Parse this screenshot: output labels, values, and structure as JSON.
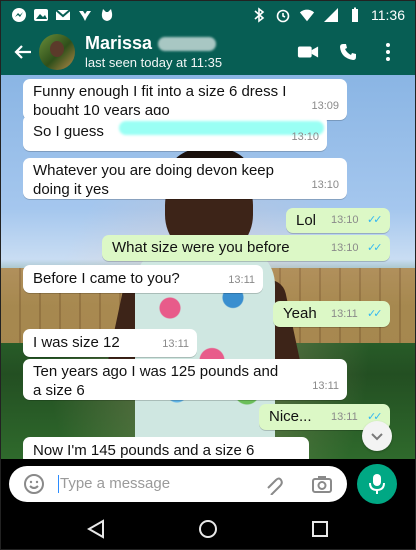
{
  "status_bar": {
    "time": "11:36",
    "icons_left": [
      "messenger-icon",
      "gallery-icon",
      "gmail-icon",
      "sports-icon",
      "cat-icon"
    ],
    "icons_right": [
      "bluetooth-icon",
      "alarm-icon",
      "wifi-icon",
      "signal-icon",
      "battery-icon"
    ]
  },
  "header": {
    "contact_name": "Marissa",
    "last_seen": "last seen today at 11:35",
    "actions": [
      "video-call-icon",
      "call-icon",
      "more-vert-icon"
    ]
  },
  "messages": [
    {
      "dir": "in",
      "lines": [
        "Funny enough I fit into a size 6 dress I",
        "bought 10 years ago"
      ],
      "time": "13:09",
      "ticks": false
    },
    {
      "dir": "in",
      "lines": [
        "So I guess"
      ],
      "time": "13:10",
      "ticks": false
    },
    {
      "dir": "in",
      "lines": [
        "Whatever you are doing devon keep",
        "doing it yes"
      ],
      "time": "13:10",
      "ticks": false
    },
    {
      "dir": "out",
      "lines": [
        "Lol"
      ],
      "time": "13:10",
      "ticks": true
    },
    {
      "dir": "out",
      "lines": [
        "What size were you before"
      ],
      "time": "13:10",
      "ticks": true
    },
    {
      "dir": "in",
      "lines": [
        "Before I came to you?"
      ],
      "time": "13:11",
      "ticks": false
    },
    {
      "dir": "out",
      "lines": [
        "Yeah"
      ],
      "time": "13:11",
      "ticks": true
    },
    {
      "dir": "in",
      "lines": [
        "I was size 12"
      ],
      "time": "13:11",
      "ticks": false
    },
    {
      "dir": "in",
      "lines": [
        "Ten years ago I was 125 pounds and",
        "a size 6"
      ],
      "time": "13:11",
      "ticks": false
    },
    {
      "dir": "out",
      "lines": [
        "Nice..."
      ],
      "time": "13:11",
      "ticks": true
    },
    {
      "dir": "in",
      "lines": [
        "Now I'm 145 pounds and a size 6"
      ],
      "time": "",
      "ticks": false
    }
  ],
  "composer": {
    "placeholder": "Type a message",
    "icons": [
      "emoji-icon",
      "attach-icon",
      "camera-icon",
      "mic-icon"
    ]
  },
  "nav": {
    "icons": [
      "back-triangle-icon",
      "home-circle-icon",
      "recents-square-icon"
    ]
  },
  "colors": {
    "header_bg": "#075e54",
    "incoming_bubble": "#ffffff",
    "outgoing_bubble": "#dcf8c6",
    "read_ticks": "#34b7f1",
    "mic_bg": "#00a884"
  }
}
